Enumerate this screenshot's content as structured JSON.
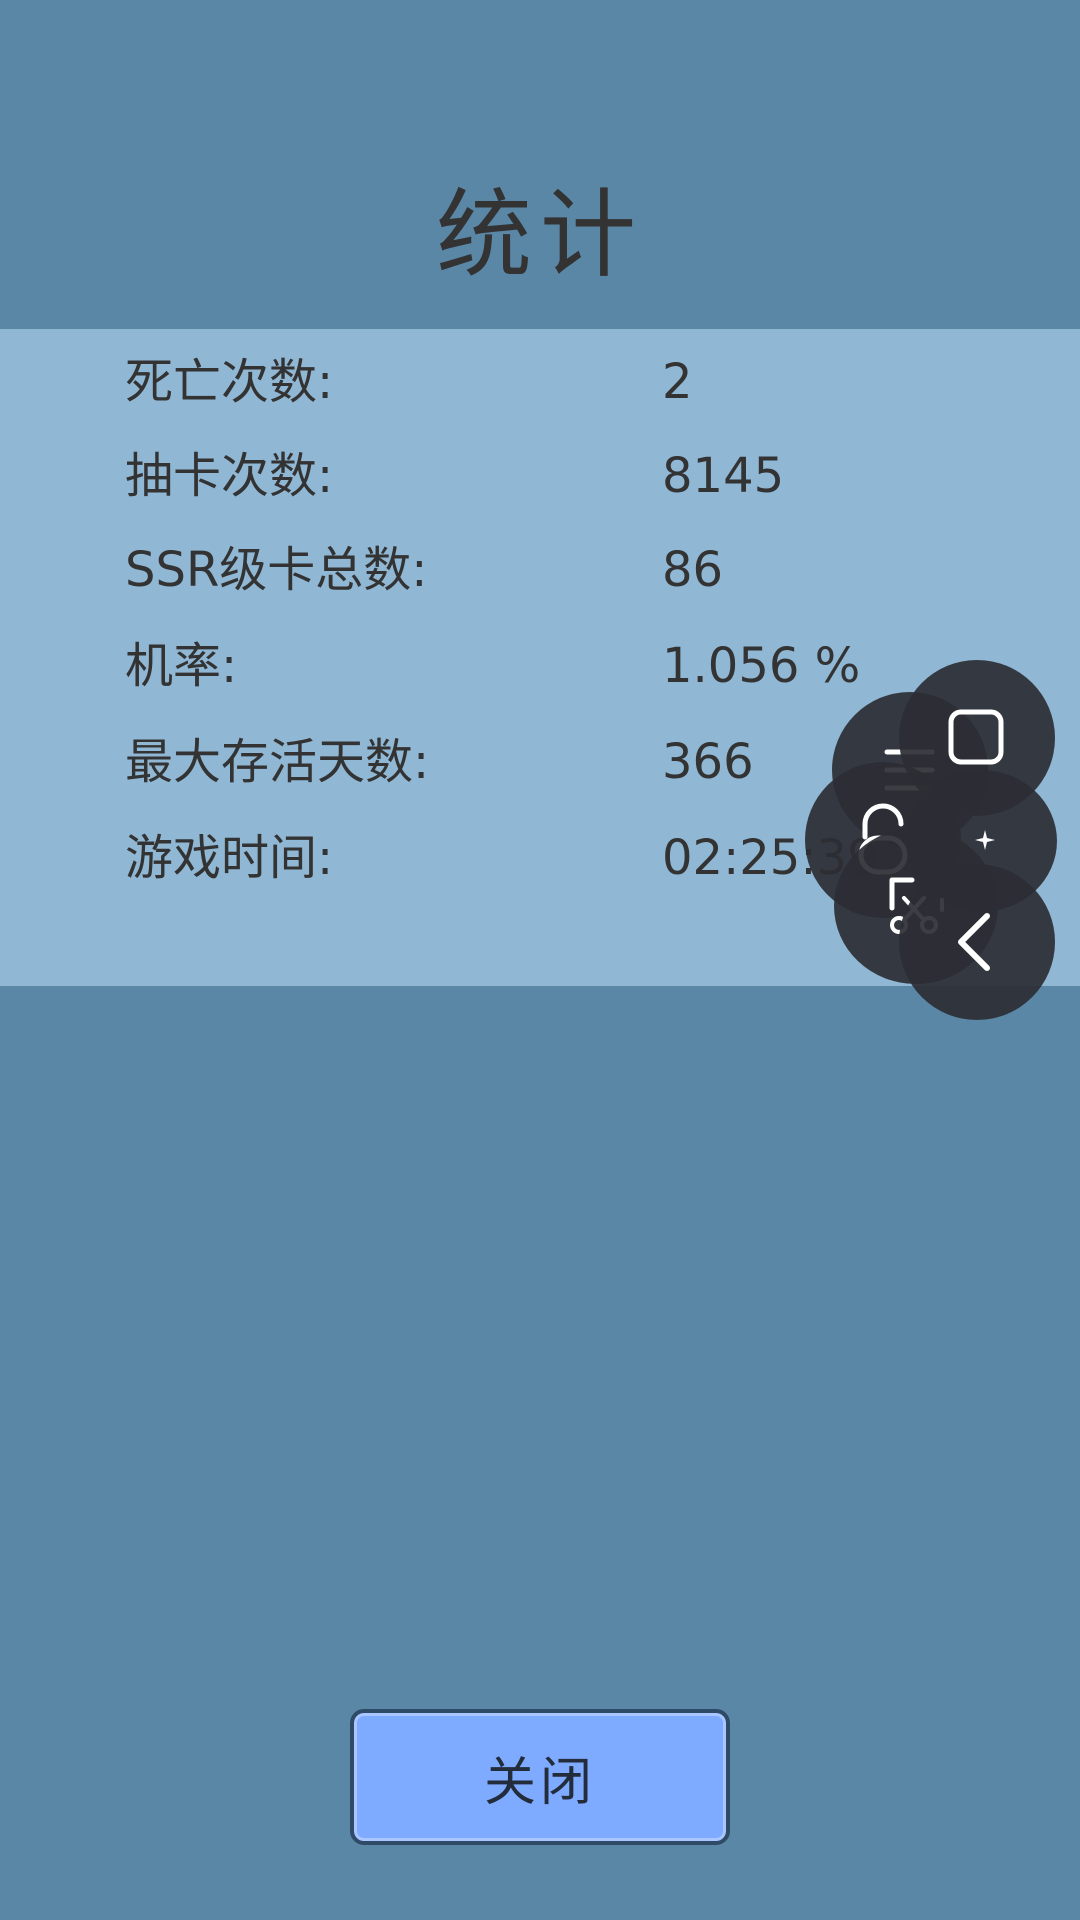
{
  "title": "统计",
  "stats": [
    {
      "label": "死亡次数:",
      "value": "2"
    },
    {
      "label": "抽卡次数:",
      "value": "8145"
    },
    {
      "label": "SSR级卡总数:",
      "value": "86"
    },
    {
      "label": "机率:",
      "value": "1.056 %"
    },
    {
      "label": "最大存活天数:",
      "value": "366"
    },
    {
      "label": "游戏时间:",
      "value": "02:25:39"
    }
  ],
  "close_button": {
    "label": "关闭"
  },
  "floating_menu": {
    "icons": [
      "menu-icon",
      "home-square-icon",
      "unlock-icon",
      "sparkle-icon",
      "screenshot-icon",
      "back-icon"
    ]
  },
  "colors": {
    "background": "#5b87a7",
    "panel": "#90b7d4",
    "button": "#7eaaff",
    "text": "#333333"
  }
}
